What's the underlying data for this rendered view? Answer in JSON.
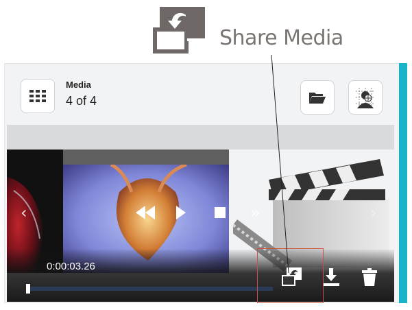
{
  "callout": {
    "label": "Share Media",
    "icon": "share-media-icon"
  },
  "header": {
    "title": "Media",
    "count": "4 of 4"
  },
  "toolbar": {
    "grid_icon": "grid-icon",
    "folder_icon": "folder-icon",
    "anatomy_icon": "anatomy-icon"
  },
  "player": {
    "timecode": "0:00:03.26",
    "progress": 0.0,
    "controls": [
      "share-icon",
      "download-icon",
      "delete-icon"
    ]
  },
  "colors": {
    "accent": "#19b3c9",
    "highlight": "#c9543a"
  }
}
